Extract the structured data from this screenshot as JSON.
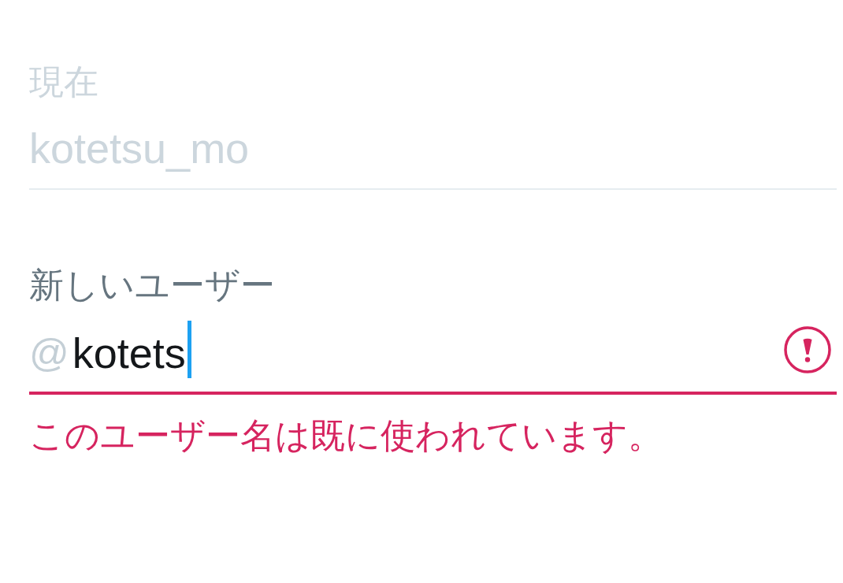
{
  "current": {
    "label": "現在",
    "value": "kotetsu_mo",
    "disabled": true
  },
  "new_username": {
    "label": "新しいユーザー",
    "prefix": "@",
    "value": "kotets",
    "focused": true,
    "error": true,
    "error_message": "このユーザー名は既に使われています。"
  }
}
